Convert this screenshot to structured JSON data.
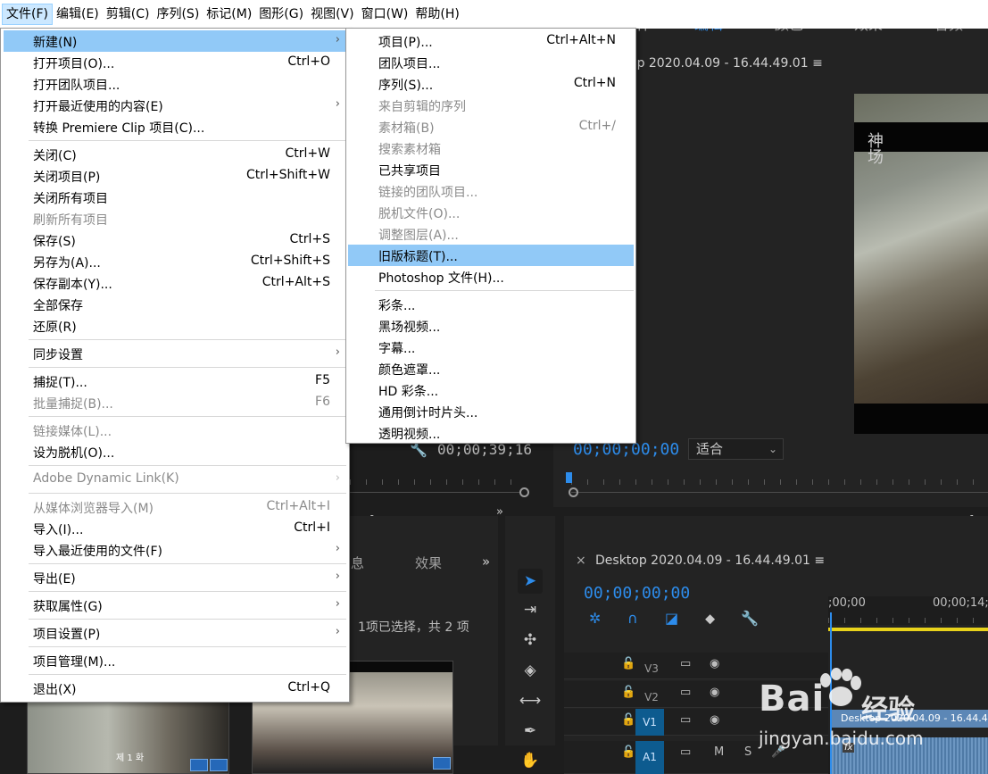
{
  "menubar": {
    "items": [
      "文件(F)",
      "编辑(E)",
      "剪辑(C)",
      "序列(S)",
      "标记(M)",
      "图形(G)",
      "视图(V)",
      "窗口(W)",
      "帮助(H)"
    ]
  },
  "file_menu": {
    "items": [
      {
        "label": "新建(N)",
        "shortcut": "",
        "submenu": true,
        "disabled": false,
        "highlighted": true
      },
      {
        "label": "打开项目(O)...",
        "shortcut": "Ctrl+O"
      },
      {
        "label": "打开团队项目..."
      },
      {
        "label": "打开最近使用的内容(E)",
        "submenu": true
      },
      {
        "label": "转换 Premiere Clip 项目(C)..."
      },
      {
        "label": "关闭(C)",
        "shortcut": "Ctrl+W"
      },
      {
        "label": "关闭项目(P)",
        "shortcut": "Ctrl+Shift+W"
      },
      {
        "label": "关闭所有项目"
      },
      {
        "label": "刷新所有项目",
        "disabled": true
      },
      {
        "label": "保存(S)",
        "shortcut": "Ctrl+S"
      },
      {
        "label": "另存为(A)...",
        "shortcut": "Ctrl+Shift+S"
      },
      {
        "label": "保存副本(Y)...",
        "shortcut": "Ctrl+Alt+S"
      },
      {
        "label": "全部保存"
      },
      {
        "label": "还原(R)"
      },
      {
        "label": "同步设置",
        "submenu": true
      },
      {
        "label": "捕捉(T)...",
        "shortcut": "F5"
      },
      {
        "label": "批量捕捉(B)...",
        "shortcut": "F6",
        "disabled": true
      },
      {
        "label": "链接媒体(L)...",
        "disabled": true
      },
      {
        "label": "设为脱机(O)..."
      },
      {
        "label": "Adobe Dynamic Link(K)",
        "submenu": true,
        "disabled": true
      },
      {
        "label": "从媒体浏览器导入(M)",
        "shortcut": "Ctrl+Alt+I",
        "disabled": true
      },
      {
        "label": "导入(I)...",
        "shortcut": "Ctrl+I"
      },
      {
        "label": "导入最近使用的文件(F)",
        "submenu": true
      },
      {
        "label": "导出(E)",
        "submenu": true
      },
      {
        "label": "获取属性(G)",
        "submenu": true
      },
      {
        "label": "项目设置(P)",
        "submenu": true
      },
      {
        "label": "项目管理(M)..."
      },
      {
        "label": "退出(X)",
        "shortcut": "Ctrl+Q"
      }
    ]
  },
  "new_submenu": {
    "items": [
      {
        "label": "项目(P)...",
        "shortcut": "Ctrl+Alt+N"
      },
      {
        "label": "团队项目..."
      },
      {
        "label": "序列(S)...",
        "shortcut": "Ctrl+N"
      },
      {
        "label": "来自剪辑的序列",
        "disabled": true
      },
      {
        "label": "素材箱(B)",
        "shortcut": "Ctrl+/",
        "disabled": true
      },
      {
        "label": "搜索素材箱",
        "disabled": true
      },
      {
        "label": "已共享项目"
      },
      {
        "label": "链接的团队项目...",
        "disabled": true
      },
      {
        "label": "脱机文件(O)...",
        "disabled": true
      },
      {
        "label": "调整图层(A)...",
        "disabled": true
      },
      {
        "label": "旧版标题(T)...",
        "highlighted": true
      },
      {
        "label": "Photoshop 文件(H)..."
      },
      {
        "label": "彩条..."
      },
      {
        "label": "黑场视频..."
      },
      {
        "label": "字幕..."
      },
      {
        "label": "颜色遮罩..."
      },
      {
        "label": "HD 彩条..."
      },
      {
        "label": "通用倒计时片头..."
      },
      {
        "label": "透明视频..."
      }
    ]
  },
  "workspace": {
    "tab_partial": "件",
    "tabs": [
      "编辑",
      "颜色",
      "效果",
      "音频"
    ],
    "active": "编辑"
  },
  "program_monitor": {
    "title": "op 2020.04.09 - 16.44.49.01 ≡",
    "timecode": "00;00;00;00",
    "fit": "适合",
    "video_logo": "神\n场"
  },
  "source_monitor": {
    "timecode": "00;00;39;16"
  },
  "project_panel": {
    "tab_partial": "息",
    "tab_effects": "效果",
    "selection": "1项已选择，共 2 项",
    "thumb_label": "제 1 화"
  },
  "timeline": {
    "title": "Desktop 2020.04.09 - 16.44.49.01 ≡",
    "close": "×",
    "timecode": "00;00;00;00",
    "ruler": [
      ";00;00",
      "00;00;14;2"
    ],
    "tracks": [
      "V3",
      "V2",
      "V1",
      "A1"
    ],
    "clip_name": "Desktop 2020.04.09 - 16.44.4",
    "fx": "fx",
    "mute": "M",
    "solo": "S"
  },
  "watermark": {
    "brand": "Bai",
    "cn": "经验",
    "url": "jingyan.baidu.com"
  },
  "colors": {
    "accent": "#2d8ceb",
    "menu_highlight": "#91c9f7",
    "menubar_active": "#cce8ff"
  }
}
